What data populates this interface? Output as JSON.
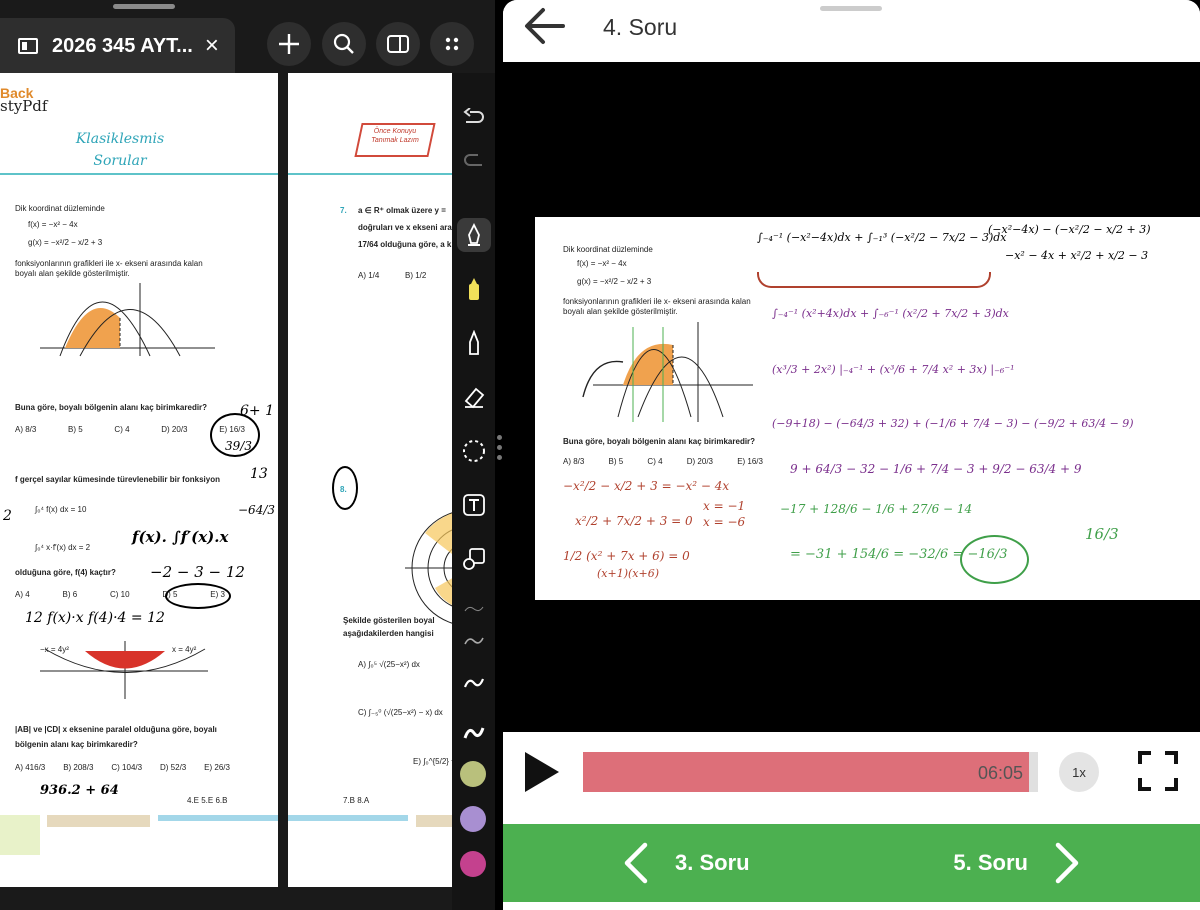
{
  "left": {
    "doc_tab": {
      "title": "2026 345 AYT...",
      "close": "×"
    },
    "page1": {
      "back_label": "Back",
      "brand": "styPdf",
      "section_title": "Klasiklesmis Sorular",
      "q1": {
        "stem": "Dik koordinat düzleminde",
        "f": "f(x) = −x² − 4x",
        "g": "g(x) = −x²/2 − x/2 + 3",
        "desc1": "fonksiyonlarının grafikleri ile x- ekseni arasında kalan",
        "desc2": "boyalı alan şekilde gösterilmiştir.",
        "question": "Buna göre, boyalı bölgenin alanı kaç birimkaredir?",
        "options": [
          "A) 8/3",
          "B) 5",
          "C) 4",
          "D) 20/3",
          "E) 16/3"
        ]
      },
      "q2": {
        "stem": "f gerçel sayılar kümesinde türevlenebilir bir fonksiyon",
        "int1": "∫₀⁴ f(x) dx = 10",
        "int2": "∫₀⁴ x·f′(x) dx = 2",
        "question": "olduğuna göre, f(4) kaçtır?",
        "options": [
          "A) 4",
          "B) 6",
          "C) 10",
          "D) 5",
          "E) 3"
        ]
      },
      "q3": {
        "curve1": "x = 4y²",
        "curve2": "−x = 4y²",
        "desc": "|AB| ve |CD| x eksenine paralel olduğuna göre, boyalı",
        "question": "bölgenin alanı kaç birimkaredir?",
        "options": [
          "A) 416/3",
          "B) 208/3",
          "C) 104/3",
          "D) 52/3",
          "E) 26/3"
        ]
      },
      "footer_code": "4.E 5.E 6.B",
      "handwriting": [
        "6+ 1",
        "13",
        "39/3",
        "2",
        "−64/3",
        "f(x). ∫f′(x).x",
        "−2 − 3 − 12",
        "12   f(x)·x   f(4)·4 = 12",
        "936.2 + 64"
      ]
    },
    "page2": {
      "badge": "Önce Konuyu Tanımak Lazım",
      "q7_num": "7.",
      "q7_line1": "a ∈ R⁺ olmak üzere y =",
      "q7_line2": "doğruları ve x ekseni ara",
      "q7_line3": "17/64 olduğuna göre, a k",
      "q7_options": [
        "A) 1/4",
        "B) 1/2"
      ],
      "q8_num": "8.",
      "q8_line1": "Şekilde gösterilen boyal",
      "q8_line2": "aşağıdakilerden hangisi",
      "q8_options": [
        "A) ∫₀⁵ √(25−x²) dx",
        "C) ∫₋₅⁰ (√(25−x²) − x) dx",
        "E) ∫₀^{5/2} √2"
      ],
      "footer_code": "7.B 8.A"
    },
    "toolbar": {
      "tools": [
        "undo-icon",
        "redo-icon",
        "pen-icon",
        "highlighter-icon",
        "marker-icon",
        "eraser-icon",
        "lasso-icon",
        "text-icon",
        "shapes-icon",
        "stroke-thin-icon",
        "stroke-medium-icon",
        "stroke-thick-icon",
        "stroke-bold-icon"
      ],
      "colors": [
        "#b9c07c",
        "#a88fd1",
        "#c4418e"
      ]
    }
  },
  "right": {
    "title": "4. Soru",
    "solution": {
      "stem": "Dik koordinat düzleminde",
      "f": "f(x) = −x² − 4x",
      "g": "g(x) = −x²/2 − x/2 + 3",
      "desc1": "fonksiyonlarının grafikleri ile x- ekseni arasında kalan",
      "desc2": "boyalı alan şekilde gösterilmiştir.",
      "question": "Buna göre, boyalı bölgenin alanı kaç birimkaredir?",
      "options": [
        "A) 8/3",
        "B) 5",
        "C) 4",
        "D) 20/3",
        "E) 16/3"
      ],
      "hand_black": [
        "∫₋₄⁻¹ (−x²−4x)dx + ∫₋₁³ (−x²/2 − 7x/2 − 3)dx",
        "(−x²−4x) − (−x²/2 − x/2 + 3)",
        "−x² − 4x + x²/2 + x/2 − 3"
      ],
      "hand_purple": [
        "∫₋₄⁻¹ (x²+4x)dx + ∫₋₆⁻¹ (x²/2 + 7x/2 + 3)dx",
        "(x³/3 + 2x²) |₋₄⁻¹ + (x³/6 + 7/4 x² + 3x) |₋₆⁻¹",
        "(−9+18) − (−64/3 + 32) + (−1/6 + 7/4 − 3) − (−9/2 + 63/4 − 9)",
        "9 + 64/3 − 32 − 1/6 + 7/4 − 3 + 9/2 − 63/4 + 9"
      ],
      "hand_green": [
        "−17 + 128/6 − 1/6 + 27/6 − 14",
        "= −31 + 154/6 = −32/6 = −16/3",
        "16/3"
      ],
      "hand_red": [
        "−x²/2 − x/2 + 3 = −x² − 4x",
        "x²/2 + 7x/2 + 3 = 0",
        "1/2 (x² + 7x + 6) = 0",
        "(x+1)(x+6)",
        "x = −1",
        "x = −6"
      ]
    },
    "player": {
      "time": "06:05",
      "speed": "1x",
      "progress": 0.98
    },
    "nav": {
      "prev": "3. Soru",
      "next": "5. Soru"
    }
  }
}
